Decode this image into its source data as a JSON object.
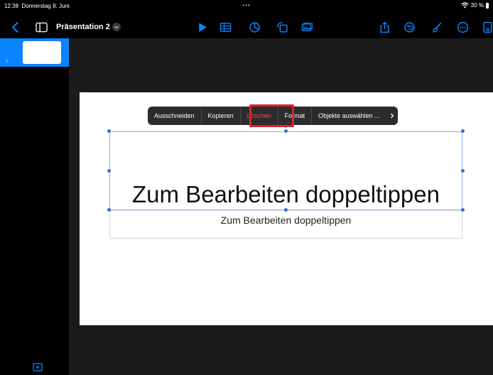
{
  "status": {
    "time": "12:38",
    "date": "Donnerstag 8. Juni",
    "dots": "•••",
    "battery": "30 %"
  },
  "toolbar": {
    "doc_title": "Präsentation 2",
    "accent": "#0a84ff",
    "icons": [
      "chevron-left-icon",
      "sidebar-icon",
      "play-icon",
      "table-icon",
      "chart-icon",
      "shapes-icon",
      "media-icon",
      "share-icon",
      "undo-icon",
      "format-brush-icon",
      "more-icon",
      "document-icon"
    ]
  },
  "sidebar": {
    "slides": [
      {
        "number": "1"
      }
    ]
  },
  "slide": {
    "title": "Zum Bearbeiten doppeltippen",
    "subtitle": "Zum Bearbeiten doppeltippen"
  },
  "context_menu": {
    "items": [
      "Ausschneiden",
      "Kopieren",
      "Löschen",
      "Format",
      "Objekte auswählen ..."
    ],
    "highlighted": "Löschen",
    "highlight_color": "#e0202f"
  }
}
